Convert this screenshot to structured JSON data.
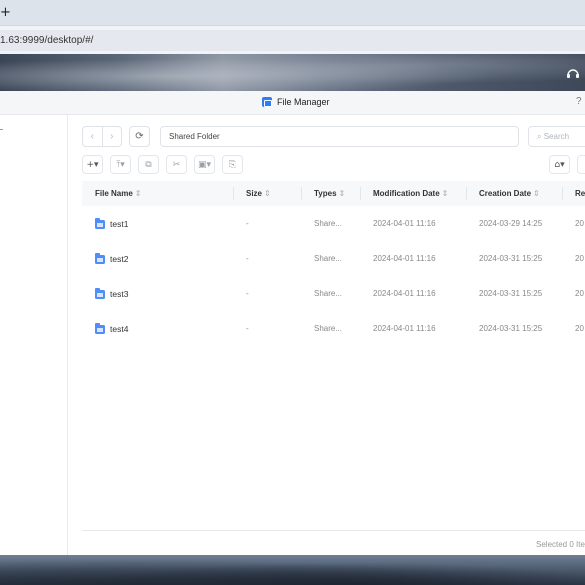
{
  "browser": {
    "new_tab_symbol": "+",
    "url": "1.63:9999/desktop/#/"
  },
  "window": {
    "title": "File Manager",
    "help_symbol": "?"
  },
  "toolbar": {
    "back_symbol": "‹",
    "forward_symbol": "›",
    "refresh_symbol": "⟳",
    "path": "Shared Folder",
    "search_placeholder": "Search"
  },
  "table": {
    "columns": [
      "File Name",
      "Size",
      "Types",
      "Modification Date",
      "Creation Date",
      "Re"
    ],
    "sort_symbol": "⇕",
    "rows": [
      {
        "name": "test1",
        "size": "-",
        "type": "Share...",
        "modified": "2024-04-01 11:16",
        "created": "2024-03-29 14:25",
        "extra": "20"
      },
      {
        "name": "test2",
        "size": "-",
        "type": "Share...",
        "modified": "2024-04-01 11:16",
        "created": "2024-03-31 15:25",
        "extra": "20"
      },
      {
        "name": "test3",
        "size": "-",
        "type": "Share...",
        "modified": "2024-04-01 11:16",
        "created": "2024-03-31 15:25",
        "extra": "20"
      },
      {
        "name": "test4",
        "size": "-",
        "type": "Share...",
        "modified": "2024-04-01 11:16",
        "created": "2024-03-31 15:25",
        "extra": "20"
      }
    ]
  },
  "footer": {
    "status": "Selected 0 Iter"
  },
  "icons": {
    "folder_color": "#4f8ef7",
    "app_color": "#2f7cf6"
  }
}
